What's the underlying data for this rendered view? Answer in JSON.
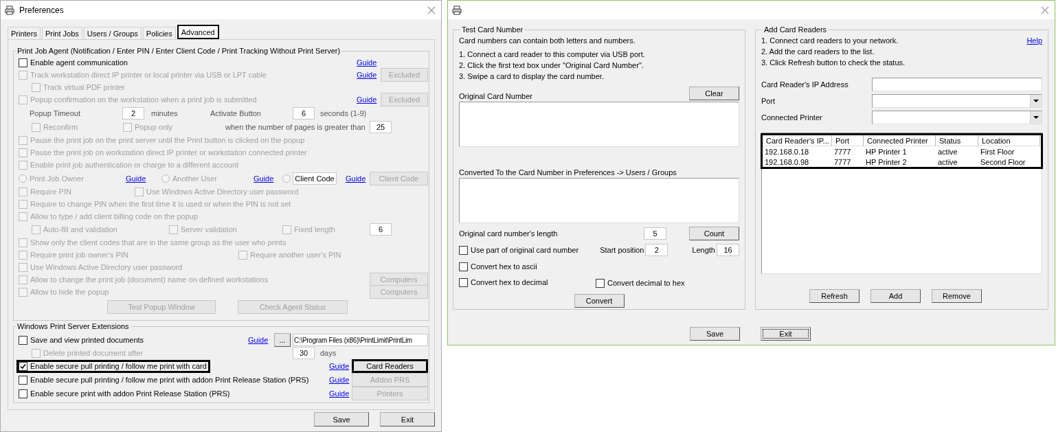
{
  "preferences": {
    "title": "Preferences",
    "tabs": [
      {
        "label": "Printers",
        "selected": false
      },
      {
        "label": "Print Jobs",
        "selected": false
      },
      {
        "label": "Users / Groups",
        "selected": false
      },
      {
        "label": "Policies",
        "selected": false
      },
      {
        "label": "Advanced",
        "selected": true
      }
    ],
    "agent_group": {
      "title": "Print Job Agent (Notification / Enter PIN / Enter Client Code / Print Tracking Without Print Server)",
      "rows": [
        {
          "items": [
            {
              "kind": "checkbox",
              "label": "Enable agent communication",
              "checked": false,
              "disabled": false
            },
            {
              "kind": "link",
              "label": "Guide"
            }
          ]
        },
        {
          "items": [
            {
              "kind": "checkbox",
              "label": "Track workstation direct IP printer or local printer via USB or LPT cable",
              "checked": false,
              "disabled": true
            },
            {
              "kind": "link",
              "label": "Guide"
            },
            {
              "kind": "button",
              "label": "Excluded",
              "disabled": true
            }
          ]
        },
        {
          "items": [
            {
              "kind": "checkbox",
              "label": "Track virtual PDF printer",
              "checked": false,
              "disabled": true
            }
          ]
        },
        {
          "items": [
            {
              "kind": "checkbox",
              "label": "Popup confirmation on the workstation when a print job is submitted",
              "checked": false,
              "disabled": true
            },
            {
              "kind": "link",
              "label": "Guide"
            },
            {
              "kind": "button",
              "label": "Excluded",
              "disabled": true
            }
          ]
        },
        {
          "items": [
            {
              "kind": "text",
              "label": "Popup Timeout"
            },
            {
              "kind": "field",
              "value": "2"
            },
            {
              "kind": "text",
              "label": "minutes"
            },
            {
              "kind": "text",
              "label": "Activate Button"
            },
            {
              "kind": "field",
              "value": "6"
            },
            {
              "kind": "text",
              "label": "seconds (1-9)"
            }
          ]
        },
        {
          "items": [
            {
              "kind": "checkbox",
              "label": "Reconfirm",
              "checked": false,
              "disabled": true
            },
            {
              "kind": "checkbox",
              "label": "Popup only",
              "checked": false,
              "disabled": true
            },
            {
              "kind": "text",
              "label": "when the number of pages is greater than"
            },
            {
              "kind": "field",
              "value": "25"
            }
          ]
        },
        {
          "items": [
            {
              "kind": "checkbox",
              "label": "Pause the print job on the print server until the Print button is clicked on the popup",
              "checked": false,
              "disabled": true
            }
          ]
        },
        {
          "items": [
            {
              "kind": "checkbox",
              "label": "Pause the print job on workstation direct IP printer or workstation connected printer",
              "checked": false,
              "disabled": true
            }
          ]
        },
        {
          "items": [
            {
              "kind": "checkbox",
              "label": "Enable print job authentication or charge to a different account",
              "checked": false,
              "disabled": true
            }
          ]
        },
        {
          "items": [
            {
              "kind": "radio",
              "label": "Print Job Owner",
              "selected": false,
              "disabled": true
            },
            {
              "kind": "link",
              "label": "Guide"
            },
            {
              "kind": "radio",
              "label": "Another User",
              "selected": false,
              "disabled": true
            },
            {
              "kind": "link",
              "label": "Guide"
            },
            {
              "kind": "radio",
              "selected": false,
              "disabled": true
            },
            {
              "kind": "field",
              "value": "Client Code"
            },
            {
              "kind": "link",
              "label": "Guide"
            },
            {
              "kind": "button",
              "label": "Client Code",
              "disabled": true
            }
          ]
        },
        {
          "items": [
            {
              "kind": "checkbox",
              "label": "Require PIN",
              "checked": false,
              "disabled": true
            },
            {
              "kind": "checkbox",
              "label": "Use Windows Active Directory user password",
              "checked": false,
              "disabled": true
            }
          ]
        },
        {
          "items": [
            {
              "kind": "checkbox",
              "label": "Require to change PIN when the first time it is used or when the PIN is not set",
              "checked": false,
              "disabled": true
            }
          ]
        },
        {
          "items": [
            {
              "kind": "checkbox",
              "label": "Allow to type / add client billing code on the popup",
              "checked": false,
              "disabled": true
            }
          ]
        },
        {
          "items": [
            {
              "kind": "checkbox",
              "label": "Auto-fill and validation",
              "checked": false,
              "disabled": true
            },
            {
              "kind": "checkbox",
              "label": "Server validation",
              "checked": false,
              "disabled": true
            },
            {
              "kind": "checkbox",
              "label": "Fixed length",
              "checked": false,
              "disabled": true
            },
            {
              "kind": "field",
              "value": "6"
            }
          ]
        },
        {
          "items": [
            {
              "kind": "checkbox",
              "label": "Show only the client codes that are in the same group as the user who prints",
              "checked": false,
              "disabled": true
            }
          ]
        },
        {
          "items": [
            {
              "kind": "checkbox",
              "label": "Require print job owner's PIN",
              "checked": false,
              "disabled": true
            },
            {
              "kind": "checkbox",
              "label": "Require another user's PIN",
              "checked": false,
              "disabled": true
            }
          ]
        },
        {
          "items": [
            {
              "kind": "checkbox",
              "label": "Use Windows Active Directory user password",
              "checked": false,
              "disabled": true
            }
          ]
        },
        {
          "items": [
            {
              "kind": "checkbox",
              "label": "Allow to change the print job (document) name on defined workstations",
              "checked": false,
              "disabled": true
            },
            {
              "kind": "button",
              "label": "Computers",
              "disabled": true
            }
          ]
        },
        {
          "items": [
            {
              "kind": "checkbox",
              "label": "Allow to hide the popup",
              "checked": false,
              "disabled": true
            },
            {
              "kind": "button",
              "label": "Computers",
              "disabled": true
            }
          ]
        },
        {
          "items": [
            {
              "kind": "button",
              "label": "Test Popup Window",
              "disabled": true
            },
            {
              "kind": "button",
              "label": "Check Agent Status",
              "disabled": true
            }
          ]
        }
      ]
    },
    "extensions_group": {
      "title": "Windows Print Server Extensions",
      "rows": [
        {
          "items": [
            {
              "kind": "checkbox",
              "label": "Save and view printed documents",
              "checked": false,
              "disabled": false
            },
            {
              "kind": "link",
              "label": "Guide"
            },
            {
              "kind": "button",
              "label": "...",
              "disabled": false
            },
            {
              "kind": "field",
              "value": "C:\\Program Files (x86)\\PrintLimit\\PrintLim"
            }
          ]
        },
        {
          "items": [
            {
              "kind": "checkbox",
              "label": "Delete printed document after",
              "checked": false,
              "disabled": true
            },
            {
              "kind": "field",
              "value": "30"
            },
            {
              "kind": "text",
              "label": "days"
            }
          ]
        },
        {
          "items": [
            {
              "kind": "checkbox",
              "label": "Enable secure pull printing / follow me print with card",
              "checked": true,
              "disabled": false,
              "highlighted": true
            },
            {
              "kind": "link",
              "label": "Guide"
            },
            {
              "kind": "button",
              "label": "Card Readers",
              "disabled": false,
              "highlighted": true
            }
          ]
        },
        {
          "items": [
            {
              "kind": "checkbox",
              "label": "Enable secure pull printing / follow me print with addon Print Release Station (PRS)",
              "checked": false,
              "disabled": false
            },
            {
              "kind": "link",
              "label": "Guide"
            },
            {
              "kind": "button",
              "label": "Addon PRS",
              "disabled": true
            }
          ]
        },
        {
          "items": [
            {
              "kind": "checkbox",
              "label": "Enable secure print with addon Print Release Station (PRS)",
              "checked": false,
              "disabled": false
            },
            {
              "kind": "link",
              "label": "Guide"
            },
            {
              "kind": "button",
              "label": "Printers",
              "disabled": true
            }
          ]
        }
      ]
    },
    "buttons": [
      {
        "label": "Save"
      },
      {
        "label": "Exit"
      }
    ]
  },
  "card_window": {
    "test_group": {
      "title": "Test Card Number",
      "intro": "Card numbers can contain both letters and numbers.",
      "steps": [
        "1. Connect a card reader to this computer via USB port.",
        "2. Click the first text box under \"Original Card Number\".",
        "3. Swipe a card to display the card number."
      ],
      "original_label": "Original Card Number",
      "clear_button": "Clear",
      "converted_label": "Converted To the Card Number in Preferences -> Users / Groups",
      "length_label": "Original card number's length",
      "length_value": "5",
      "count_button": "Count",
      "use_part": {
        "label": "Use part of original card number",
        "checked": false
      },
      "start_position": {
        "label": "Start position",
        "value": "2"
      },
      "length": {
        "label": "Length",
        "value": "16"
      },
      "hex_to_ascii": {
        "label": "Convert hex to ascii",
        "checked": false
      },
      "hex_to_decimal": {
        "label": "Convert hex to decimal",
        "checked": false
      },
      "decimal_to_hex": {
        "label": "Convert decimal to hex",
        "checked": false
      },
      "convert_button": "Convert"
    },
    "readers_group": {
      "title": "Add Card Readers",
      "steps": [
        "1. Connect card readers to your network.",
        "2. Add the card readers to the list.",
        "3. Click Refresh button to check the status."
      ],
      "help_link": "Help",
      "fields": [
        {
          "label": "Card Reader's IP Address",
          "kind": "text"
        },
        {
          "label": "Port",
          "kind": "dropdown"
        },
        {
          "label": "Connected Printer",
          "kind": "dropdown"
        }
      ],
      "table": {
        "highlighted": true,
        "columns": [
          "Card Reader's IP...",
          "Port",
          "Connected Printer",
          "Status",
          "Location"
        ],
        "rows": [
          [
            "192.168.0.18",
            "7777",
            "HP Printer 1",
            "active",
            "First Floor"
          ],
          [
            "192.168.0.98",
            "7777",
            "HP Printer 2",
            "active",
            "Second Floor"
          ]
        ]
      },
      "buttons": [
        "Refresh",
        "Add",
        "Remove"
      ]
    },
    "buttons": [
      {
        "label": "Save",
        "focused": false
      },
      {
        "label": "Exit",
        "focused": true
      }
    ]
  }
}
